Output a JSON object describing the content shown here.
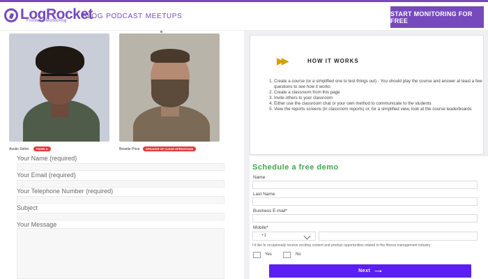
{
  "brand": {
    "name": "LogRocket",
    "tagline": "Frontend Monitoring",
    "color": "#764abc"
  },
  "nav": {
    "items": [
      "BLOG",
      "PODCAST",
      "MEETUPS"
    ]
  },
  "cta": {
    "label": "START MONITORING FOR FREE"
  },
  "people": [
    {
      "name": "Austin Seher",
      "tag": "PAMELA"
    },
    {
      "name": "Beastie Price",
      "tag": "SPEAKER OF CLEAR OPERATIONS"
    }
  ],
  "contact_form": {
    "name_label": "Your Name (required)",
    "email_label": "Your Email (required)",
    "phone_label": "Your Telephone Number (required)",
    "subject_label": "Subject",
    "message_label": "Your Message"
  },
  "how_it_works": {
    "title": "HOW IT WORKS",
    "steps": [
      "Create a course (or a simplified one to test things out) - You should play the course and answer at least a few questions to see how it works",
      "Create a classroom from this page",
      "Invite others to your classroom",
      "Either use the classroom chat or your own method to communicate to the students",
      "View the reports screens (in classroom reports) or, for a simplified view, look at the course leaderboards"
    ]
  },
  "demo": {
    "title": "Schedule a free demo",
    "name_label": "Name",
    "last_name_label": "Last Name",
    "email_label": "Business E-mail*",
    "mobile_label": "Mobile*",
    "country_code": "+1",
    "consent_text": "I'd like to occasionally receive exciting content and product opportunities related to the fitness management industry",
    "yes_label": "Yes",
    "no_label": "No",
    "next_label": "Next",
    "title_color": "#3aa94a",
    "button_color": "#5b1ff2"
  }
}
